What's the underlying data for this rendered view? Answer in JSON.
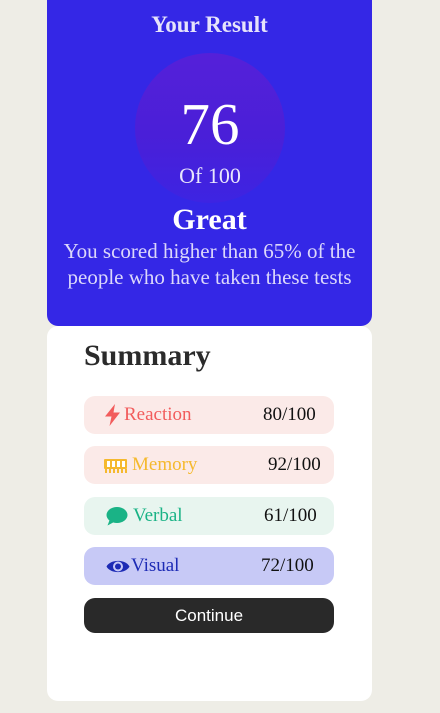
{
  "result": {
    "heading": "Your Result",
    "score": "76",
    "total": "Of 100",
    "grade": "Great",
    "description": "You scored higher than 65% of the people who have taken these tests"
  },
  "summary": {
    "title": "Summary",
    "items": [
      {
        "label": "Reaction",
        "score": "80/100",
        "icon": "lightning-bolt-icon",
        "color": "#f25c5c",
        "bg": "#fbeae8"
      },
      {
        "label": "Memory",
        "score": "92/100",
        "icon": "memory-chip-icon",
        "color": "#f5b92e",
        "bg": "#fbeae8"
      },
      {
        "label": "Verbal",
        "score": "61/100",
        "icon": "chat-bubble-icon",
        "color": "#1ab386",
        "bg": "#e8f5ef"
      },
      {
        "label": "Visual",
        "score": "72/100",
        "icon": "eye-icon",
        "color": "#1d2bb5",
        "bg": "#c7c9f6"
      }
    ],
    "continue_label": "Continue"
  },
  "colors": {
    "result_bg": "#3427e6",
    "page_bg": "#eeede6",
    "button_bg": "#292929"
  }
}
